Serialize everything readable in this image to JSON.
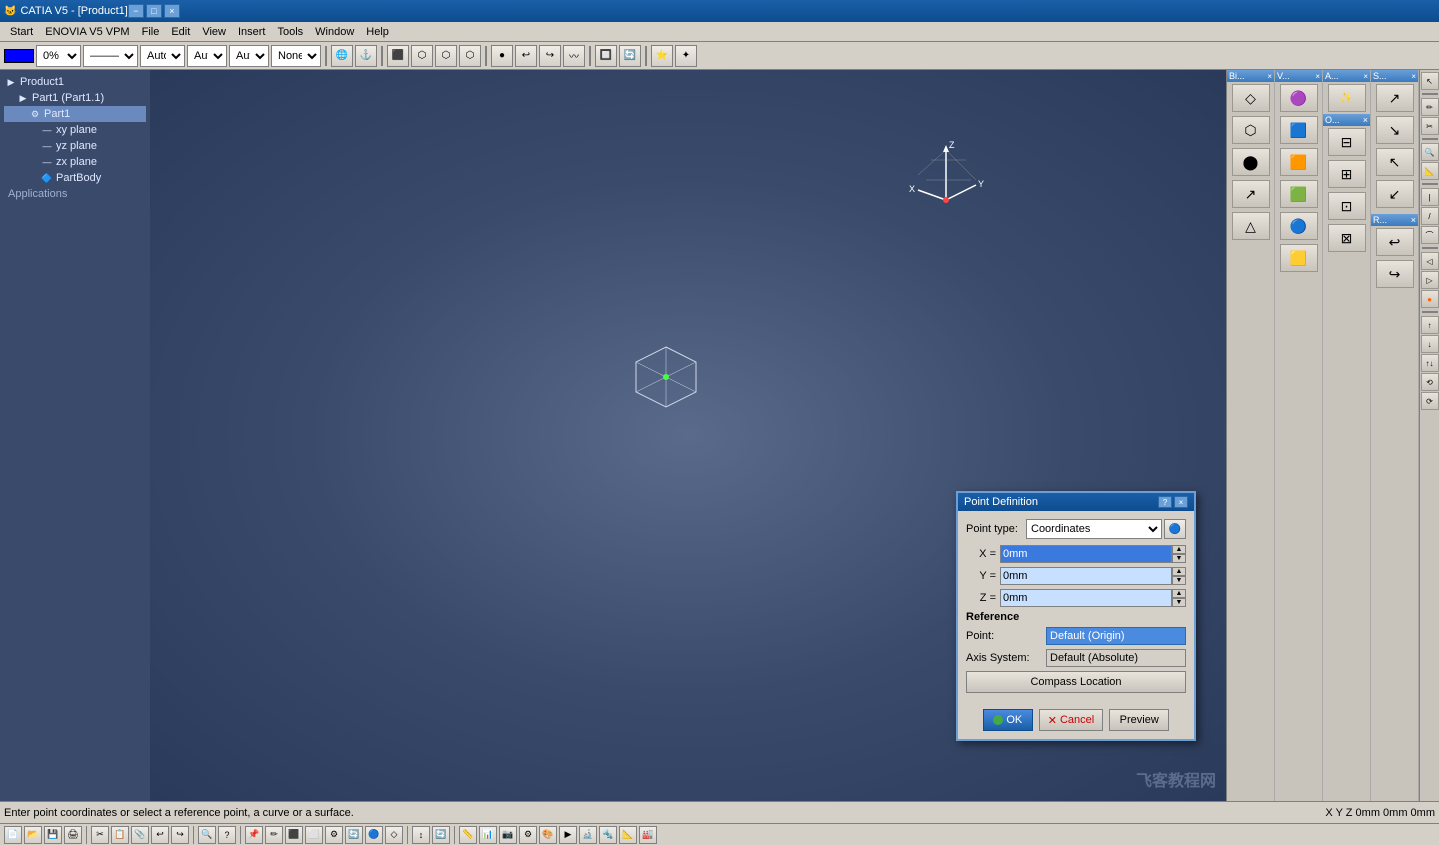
{
  "title_bar": {
    "text": "CATIA V5 - [Product1]",
    "min_label": "−",
    "max_label": "□",
    "close_label": "×"
  },
  "menu": {
    "items": [
      "Start",
      "ENOVIA V5 VPM",
      "File",
      "Edit",
      "View",
      "Insert",
      "Tools",
      "Window",
      "Help"
    ]
  },
  "toolbar": {
    "color_value": "#0000ff",
    "percent": "0%",
    "line_type": "Auto",
    "thickness": "Aut",
    "layer": "Aut",
    "graphic": "None"
  },
  "tree": {
    "items": [
      {
        "label": "Product1",
        "level": 0,
        "icon": "📦"
      },
      {
        "label": "Part1 (Part1.1)",
        "level": 1,
        "icon": "🔩"
      },
      {
        "label": "Part1",
        "level": 2,
        "icon": "⚙",
        "selected": true
      },
      {
        "label": "xy plane",
        "level": 3,
        "icon": "📐"
      },
      {
        "label": "yz plane",
        "level": 3,
        "icon": "📐"
      },
      {
        "label": "zx plane",
        "level": 3,
        "icon": "📐"
      },
      {
        "label": "PartBody",
        "level": 3,
        "icon": "🔷"
      }
    ],
    "applications_label": "Applications"
  },
  "dialog": {
    "title": "Point Definition",
    "help_btn": "?",
    "close_btn": "×",
    "point_type_label": "Point type:",
    "point_type_value": "Coordinates",
    "x_label": "X =",
    "x_value": "0mm",
    "y_label": "Y =",
    "y_value": "0mm",
    "z_label": "Z =",
    "z_value": "0mm",
    "reference_title": "Reference",
    "point_label": "Point:",
    "point_value": "Default (Origin)",
    "axis_label": "Axis System:",
    "axis_value": "Default (Absolute)",
    "compass_btn": "Compass Location",
    "ok_btn": "OK",
    "cancel_btn": "Cancel",
    "preview_btn": "Preview"
  },
  "status_bar": {
    "left": "Enter point coordinates or select a reference point, a curve or a surface.",
    "right": "X Y Z  0mm 0mm 0mm"
  },
  "palettes": {
    "bi": {
      "title": "Bi...",
      "close": "×"
    },
    "v": {
      "title": "V...",
      "close": "×"
    },
    "a": {
      "title": "A...",
      "close": "×"
    },
    "s": {
      "title": "S...",
      "close": "×"
    },
    "o": {
      "title": "O...",
      "close": "×"
    },
    "r": {
      "title": "R...",
      "close": "×"
    }
  },
  "right_tools": {
    "icons": [
      "↖",
      "✏",
      "✂",
      "📋",
      "🔍",
      "⚙",
      "🔄",
      "📐",
      "📏",
      "⬛",
      "◻",
      "△",
      "⬤",
      "◇",
      "⬡",
      "🔺"
    ]
  },
  "bottom_toolbar": {
    "icons": [
      "📄",
      "💾",
      "🖨",
      "✂",
      "📋",
      "↩",
      "↪",
      "🔍",
      "?",
      "📌",
      "🔷",
      "⚡",
      "🔧",
      "📊",
      "⚙"
    ]
  },
  "watermark": "飞客教程网"
}
